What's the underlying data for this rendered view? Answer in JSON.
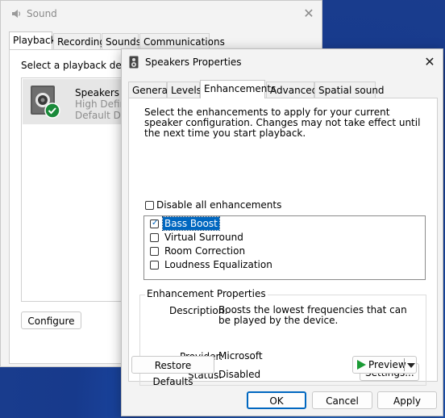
{
  "sound_window": {
    "title": "Sound",
    "close_glyph": "✕",
    "tabs": [
      {
        "label": "Playback",
        "active": true
      },
      {
        "label": "Recording",
        "active": false
      },
      {
        "label": "Sounds",
        "active": false
      },
      {
        "label": "Communications",
        "active": false
      }
    ],
    "prompt": "Select a playback device",
    "device": {
      "name": "Speakers",
      "line1": "High Defini",
      "line2": "Default Dev",
      "status_icon": "check-badge-icon"
    },
    "configure_label": "Configure"
  },
  "props_dialog": {
    "title": "Speakers Properties",
    "close_glyph": "✕",
    "tabs": [
      {
        "label": "General",
        "active": false
      },
      {
        "label": "Levels",
        "active": false
      },
      {
        "label": "Enhancements",
        "active": true
      },
      {
        "label": "Advanced",
        "active": false
      },
      {
        "label": "Spatial sound",
        "active": false
      }
    ],
    "instructions": "Select the enhancements to apply for your current speaker configuration. Changes may not take effect until the next time you start playback.",
    "disable_all": {
      "label": "Disable all enhancements",
      "checked": false
    },
    "enhancements": [
      {
        "label": "Bass Boost",
        "checked": true,
        "selected": true
      },
      {
        "label": "Virtual Surround",
        "checked": false,
        "selected": false
      },
      {
        "label": "Room Correction",
        "checked": false,
        "selected": false
      },
      {
        "label": "Loudness Equalization",
        "checked": false,
        "selected": false
      }
    ],
    "properties": {
      "group_title": "Enhancement Properties",
      "description_key": "Description:",
      "description_value": "Boosts the lowest frequencies that can be played by the device.",
      "provider_key": "Provider:",
      "provider_value": "Microsoft",
      "status_key": "Status:",
      "status_value": "Disabled",
      "settings_label": "Settings..."
    },
    "restore_defaults_label": "Restore Defaults",
    "preview_label": "Preview",
    "ok_label": "OK",
    "cancel_label": "Cancel",
    "apply_label": "Apply"
  },
  "colors": {
    "accent": "#0067c0",
    "preview_play": "#1a9b35",
    "check_badge": "#1a8a3a"
  }
}
